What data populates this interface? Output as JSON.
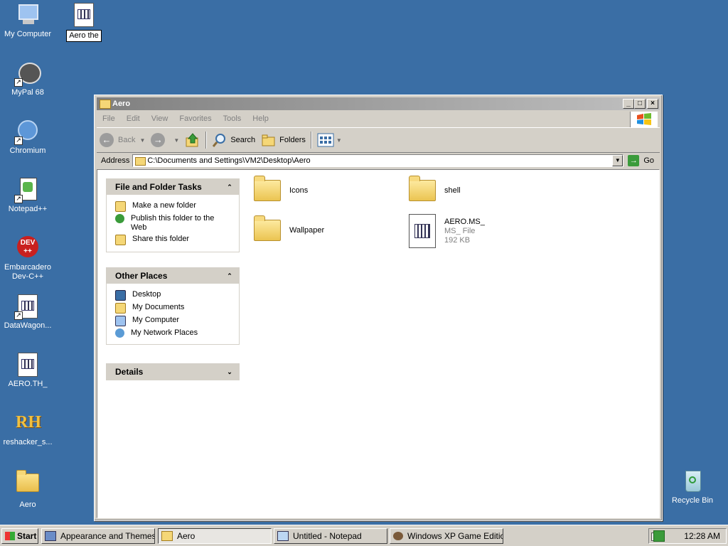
{
  "desktop": {
    "icons": [
      {
        "label": "My Computer"
      },
      {
        "label": "MyPal 68"
      },
      {
        "label": "Chromium"
      },
      {
        "label": "Notepad++"
      },
      {
        "label": "Embarcadero Dev-C++"
      },
      {
        "label": "DataWagon..."
      },
      {
        "label": "AERO.TH_"
      },
      {
        "label": "reshacker_s..."
      },
      {
        "label": "Aero"
      },
      {
        "label": "Recycle Bin"
      }
    ],
    "rename_icon": {
      "label": "Aero the"
    },
    "icon_glyphs": {
      "dev": "DEV",
      "devpp": "++",
      "rh": "RH"
    }
  },
  "window": {
    "title": "Aero",
    "menu": [
      "File",
      "Edit",
      "View",
      "Favorites",
      "Tools",
      "Help"
    ],
    "toolbar": {
      "back": "Back",
      "search": "Search",
      "folders": "Folders"
    },
    "address": {
      "label": "Address",
      "value": "C:\\Documents and Settings\\VM2\\Desktop\\Aero",
      "go": "Go"
    },
    "task_pane": {
      "file_tasks": {
        "title": "File and Folder Tasks",
        "links": [
          "Make a new folder",
          "Publish this folder to the Web",
          "Share this folder"
        ]
      },
      "other_places": {
        "title": "Other Places",
        "links": [
          "Desktop",
          "My Documents",
          "My Computer",
          "My Network Places"
        ]
      },
      "details": {
        "title": "Details"
      }
    },
    "items": [
      {
        "name": "Icons"
      },
      {
        "name": "shell"
      },
      {
        "name": "Wallpaper"
      },
      {
        "name": "AERO.MS_",
        "type": "MS_ File",
        "size": "192 KB"
      }
    ]
  },
  "taskbar": {
    "start": "Start",
    "tasks": [
      "Appearance and Themes",
      "Aero",
      "Untitled - Notepad",
      "Windows XP Game Editio..."
    ],
    "clock": "12:28 AM"
  }
}
